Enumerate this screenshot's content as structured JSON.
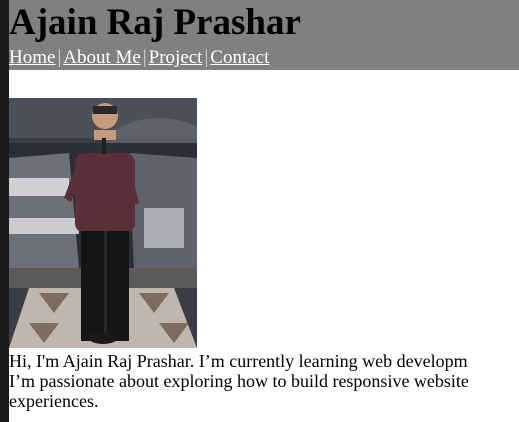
{
  "header": {
    "title": "Ajain Raj Prashar",
    "separator": "|",
    "nav": [
      "Home",
      "About Me",
      "Project",
      "Contact"
    ]
  },
  "photo": {
    "alt": "Ajain Raj Prashar"
  },
  "intro": {
    "lines": [
      "Hi, I'm Ajain Raj Prashar. I’m currently learning web developm",
      "I’m passionate about exploring how to build responsive website",
      "experiences."
    ]
  }
}
